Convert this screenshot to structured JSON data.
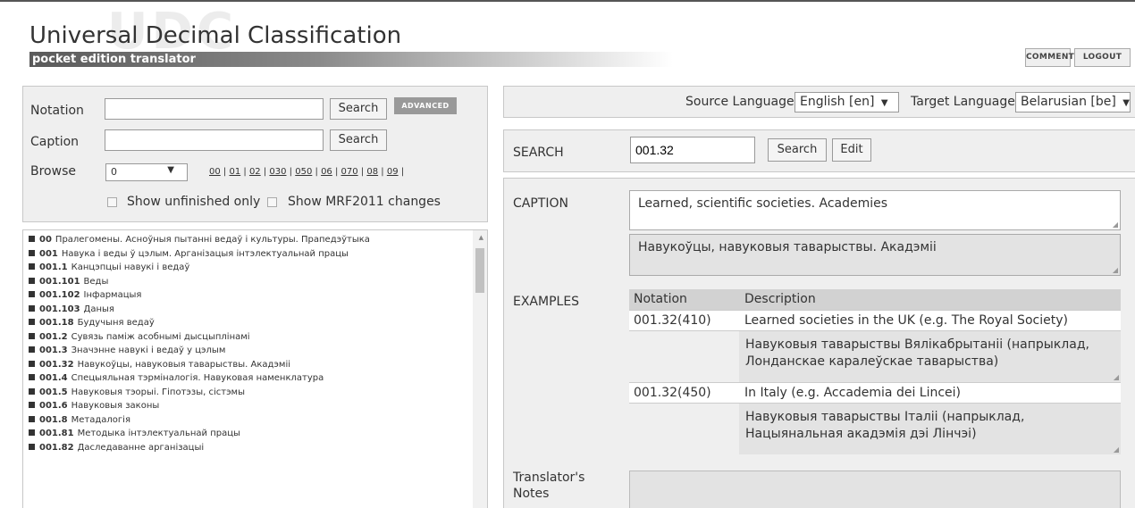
{
  "header": {
    "watermark": "UDC",
    "title": "Universal Decimal Classification",
    "subtitle": "pocket edition translator",
    "comments_label": "COMMENTS",
    "logout_label": "LOGOUT"
  },
  "left_search": {
    "notation_label": "Notation",
    "notation_value": "",
    "notation_search_label": "Search",
    "advanced_label": "ADVANCED",
    "caption_label": "Caption",
    "caption_value": "",
    "caption_search_label": "Search",
    "browse_label": "Browse",
    "browse_selected": "0",
    "browse_links": [
      "00",
      "01",
      "02",
      "030",
      "050",
      "06",
      "070",
      "08",
      "09"
    ],
    "show_unfinished_label": "Show unfinished only",
    "show_mrf_label": "Show MRF2011 changes"
  },
  "tree": [
    {
      "code": "00",
      "label": "Пралегомены. Асноўныя пытанні ведаў і культуры. Прапедэўтыка"
    },
    {
      "code": "001",
      "label": "Навука і веды ў цэлым. Арганізацыя інтэлектуальнай працы"
    },
    {
      "code": "001.1",
      "label": "Канцэпцыі навукі і ведаў"
    },
    {
      "code": "001.101",
      "label": "Веды"
    },
    {
      "code": "001.102",
      "label": "Інфармацыя"
    },
    {
      "code": "001.103",
      "label": "Даныя"
    },
    {
      "code": "001.18",
      "label": "Будучыня ведаў"
    },
    {
      "code": "001.2",
      "label": "Сувязь паміж асобнымі дысцыплінамі"
    },
    {
      "code": "001.3",
      "label": "Значэнне навукі і ведаў у цэлым"
    },
    {
      "code": "001.32",
      "label": "Навукоўцы, навуковыя таварыствы. Акадэміі"
    },
    {
      "code": "001.4",
      "label": "Спецыяльная тэрміналогія. Навуковая наменклатура"
    },
    {
      "code": "001.5",
      "label": "Навуковыя тэорыі. Гіпотэзы, сістэмы"
    },
    {
      "code": "001.6",
      "label": "Навуковыя законы"
    },
    {
      "code": "001.8",
      "label": "Метадалогія"
    },
    {
      "code": "001.81",
      "label": "Методыка інтэлектуальнай працы"
    },
    {
      "code": "001.82",
      "label": "Даследаванне арганізацыі"
    }
  ],
  "languages": {
    "source_label": "Source Language",
    "source_value": "English [en]",
    "target_label": "Target Language",
    "target_value": "Belarusian [be]"
  },
  "search": {
    "label": "SEARCH",
    "value": "001.32",
    "search_label": "Search",
    "edit_label": "Edit"
  },
  "caption": {
    "label": "CAPTION",
    "source": "Learned, scientific societies. Academies",
    "target": "Навукоўцы, навуковыя таварыствы. Акадэміі"
  },
  "examples": {
    "label": "EXAMPLES",
    "col_notation": "Notation",
    "col_description": "Description",
    "rows": [
      {
        "notation": "001.32(410)",
        "description": "Learned societies in the UK (e.g. The Royal Society)",
        "translation": "Навуковыя таварыствы Вялікабрытаніі (напрыклад, Лонданскае каралеўскае таварыства)"
      },
      {
        "notation": "001.32(450)",
        "description": "In Italy (e.g. Accademia dei Lincei)",
        "translation": "Навуковыя таварыствы Італіі (напрыклад, Нацыянальная акадэмія дэі Лінчэі)"
      }
    ]
  },
  "notes": {
    "label": "Translator's Notes"
  }
}
